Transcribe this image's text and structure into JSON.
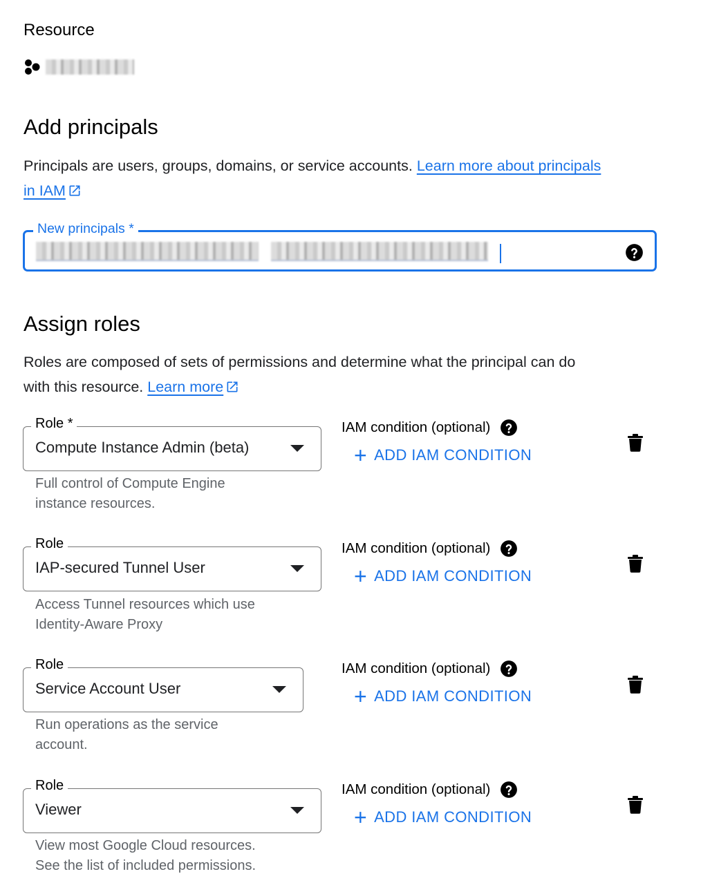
{
  "resource": {
    "heading": "Resource",
    "icon": "resource-hexagon-icon",
    "name_redacted": true
  },
  "add_principals": {
    "heading": "Add principals",
    "description": "Principals are users, groups, domains, or service accounts.",
    "link_text": "Learn more about principals in IAM",
    "link_line1": "Learn more about principals",
    "link_line2": "in IAM",
    "field_label": "New principals *",
    "field_value_redacted": true
  },
  "assign_roles": {
    "heading": "Assign roles",
    "description_line1": "Roles are composed of sets of permissions and determine what the principal can do",
    "description_line2": "with this resource.",
    "link_text": "Learn more"
  },
  "roles": [
    {
      "label": "Role *",
      "value": "Compute Instance Admin (beta)",
      "desc_line1": "Full control of Compute Engine",
      "desc_line2": "instance resources.",
      "condition_label": "IAM condition (optional)",
      "add_condition": "ADD IAM CONDITION"
    },
    {
      "label": "Role",
      "value": "IAP-secured Tunnel User",
      "desc_line1": "Access Tunnel resources which use",
      "desc_line2": "Identity-Aware Proxy",
      "condition_label": "IAM condition (optional)",
      "add_condition": "ADD IAM CONDITION"
    },
    {
      "label": "Role",
      "value": "Service Account User",
      "desc_line1": "Run operations as the service",
      "desc_line2": "account.",
      "condition_label": "IAM condition (optional)",
      "add_condition": "ADD IAM CONDITION"
    },
    {
      "label": "Role",
      "value": "Viewer",
      "desc_line1": "View most Google Cloud resources.",
      "desc_line2": "See the list of included permissions.",
      "condition_label": "IAM condition (optional)",
      "add_condition": "ADD IAM CONDITION"
    }
  ],
  "colors": {
    "accent": "#1a73e8",
    "text": "#202124",
    "secondary_text": "#5f6368",
    "outline": "#757575"
  }
}
